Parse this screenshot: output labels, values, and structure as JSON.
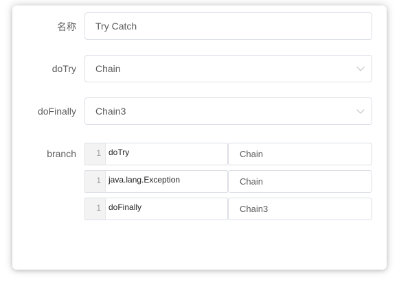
{
  "form": {
    "name": {
      "label": "名称",
      "value": "Try Catch"
    },
    "doTry": {
      "label": "doTry",
      "value": "Chain"
    },
    "doFinally": {
      "label": "doFinally",
      "value": "Chain3"
    },
    "branch": {
      "label": "branch",
      "rows": [
        {
          "line": "1",
          "key": "doTry",
          "value": "Chain"
        },
        {
          "line": "1",
          "key": "java.lang.Exception",
          "value": "Chain"
        },
        {
          "line": "1",
          "key": "doFinally",
          "value": "Chain3"
        }
      ]
    }
  }
}
